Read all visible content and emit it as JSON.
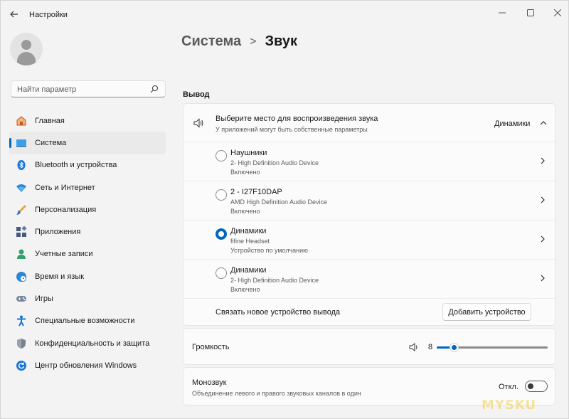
{
  "window": {
    "title": "Настройки"
  },
  "sidebar": {
    "search_placeholder": "Найти параметр",
    "items": [
      {
        "label": "Главная",
        "icon": "home-icon",
        "active": false
      },
      {
        "label": "Система",
        "icon": "system-icon",
        "active": true
      },
      {
        "label": "Bluetooth и устройства",
        "icon": "bluetooth-icon",
        "active": false
      },
      {
        "label": "Сеть и Интернет",
        "icon": "wifi-icon",
        "active": false
      },
      {
        "label": "Персонализация",
        "icon": "brush-icon",
        "active": false
      },
      {
        "label": "Приложения",
        "icon": "apps-icon",
        "active": false
      },
      {
        "label": "Учетные записи",
        "icon": "account-icon",
        "active": false
      },
      {
        "label": "Время и язык",
        "icon": "globe-clock-icon",
        "active": false
      },
      {
        "label": "Игры",
        "icon": "gamepad-icon",
        "active": false
      },
      {
        "label": "Специальные возможности",
        "icon": "accessibility-icon",
        "active": false
      },
      {
        "label": "Конфиденциальность и защита",
        "icon": "shield-icon",
        "active": false
      },
      {
        "label": "Центр обновления Windows",
        "icon": "update-icon",
        "active": false
      }
    ]
  },
  "breadcrumb": {
    "parent": "Система",
    "separator": ">",
    "current": "Звук"
  },
  "output": {
    "section_title": "Вывод",
    "header_title": "Выберите место для воспроизведения звука",
    "header_subtitle": "У приложений могут быть собственные параметры",
    "selected": "Динамики",
    "devices": [
      {
        "name": "Наушники",
        "driver": "2- High Definition Audio Device",
        "status": "Включено",
        "selected": false
      },
      {
        "name": "2 - I27F10DAP",
        "driver": "AMD High Definition Audio Device",
        "status": "Включено",
        "selected": false
      },
      {
        "name": "Динамики",
        "driver": "fifine Headset",
        "status": "Устройство по умолчанию",
        "selected": true
      },
      {
        "name": "Динамики",
        "driver": "2- High Definition Audio Device",
        "status": "Включено",
        "selected": false
      }
    ],
    "pair_label": "Связать новое устройство вывода",
    "add_button": "Добавить устройство"
  },
  "volume": {
    "label": "Громкость",
    "value": "8",
    "level": 0.08
  },
  "mono": {
    "title": "Монозвук",
    "subtitle": "Объединение левого и правого звуковых каналов в один",
    "state": "Откл."
  },
  "watermark": "MYSKU",
  "colors": {
    "accent": "#0067c0",
    "background": "#f3f3f3",
    "card": "#fbfbfb"
  }
}
